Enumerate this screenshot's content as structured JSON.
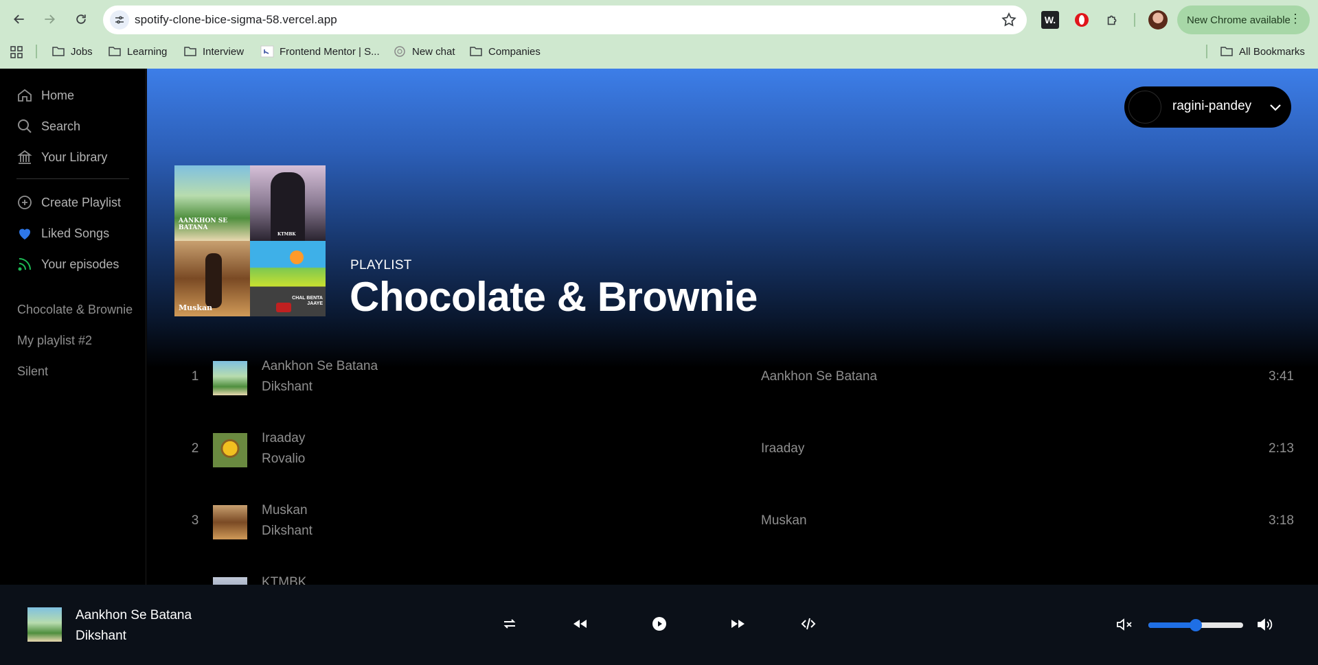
{
  "browser": {
    "url": "spotify-clone-bice-sigma-58.vercel.app",
    "update_label": "New Chrome available",
    "ext_w_label": "W.",
    "bookmarks": [
      {
        "label": "Jobs",
        "icon": "folder-icon"
      },
      {
        "label": "Learning",
        "icon": "folder-icon"
      },
      {
        "label": "Interview",
        "icon": "folder-icon"
      },
      {
        "label": "Frontend Mentor | S...",
        "icon": "frontend-mentor-icon"
      },
      {
        "label": "New chat",
        "icon": "chatgpt-icon"
      },
      {
        "label": "Companies",
        "icon": "folder-icon"
      }
    ],
    "all_bookmarks_label": "All Bookmarks"
  },
  "sidebar": {
    "nav": [
      {
        "label": "Home",
        "icon": "home-icon"
      },
      {
        "label": "Search",
        "icon": "search-icon"
      },
      {
        "label": "Your Library",
        "icon": "library-icon"
      }
    ],
    "actions": [
      {
        "label": "Create Playlist",
        "icon": "plus-circle-icon"
      },
      {
        "label": "Liked Songs",
        "icon": "heart-icon"
      },
      {
        "label": "Your episodes",
        "icon": "rss-icon"
      }
    ],
    "playlists": [
      "Chocolate & Brownie",
      "My playlist #2",
      "Silent"
    ]
  },
  "user": {
    "name": "ragini-pandey"
  },
  "playlist": {
    "type_label": "PLAYLIST",
    "title": "Chocolate & Brownie",
    "cover_captions": {
      "tile1": "AANKHON SE BATANA",
      "tile2": "KTMBK",
      "tile3": "Muskan",
      "tile4": "CHAL BENTA JAAYE"
    }
  },
  "tracks": [
    {
      "num": "1",
      "name": "Aankhon Se Batana",
      "artist": "Dikshant",
      "album": "Aankhon Se Batana",
      "duration": "3:41"
    },
    {
      "num": "2",
      "name": "Iraaday",
      "artist": "Rovalio",
      "album": "Iraaday",
      "duration": "2:13"
    },
    {
      "num": "3",
      "name": "Muskan",
      "artist": "Dikshant",
      "album": "Muskan",
      "duration": "3:18"
    },
    {
      "num": "",
      "name": "KTMBK",
      "artist": "",
      "album": "",
      "duration": ""
    }
  ],
  "player": {
    "now_playing_title": "Aankhon Se Batana",
    "now_playing_artist": "Dikshant",
    "volume_fraction": 0.5,
    "colors": {
      "accent": "#1f6fe5",
      "bar_bg": "#0b1018"
    }
  }
}
